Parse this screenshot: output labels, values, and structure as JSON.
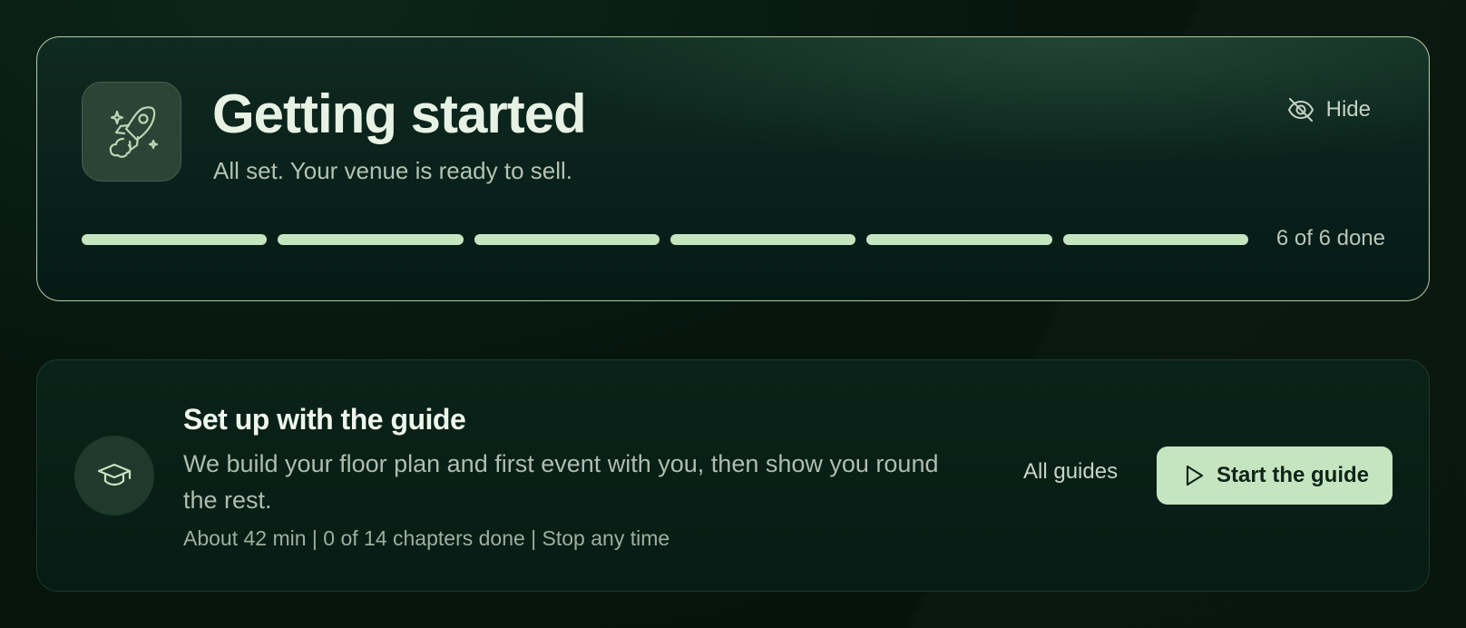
{
  "getting_started": {
    "title": "Getting started",
    "subtitle": "All set. Your venue is ready to sell.",
    "icon": "rocket-icon",
    "hide_label": "Hide",
    "hide_icon": "eye-off-icon",
    "progress": {
      "completed": 6,
      "total": 6,
      "label": "6 of 6 done"
    }
  },
  "guide": {
    "icon": "graduation-cap-icon",
    "title": "Set up with the guide",
    "description": "We build your floor plan and first event with you, then show you round the rest.",
    "meta": "About 42 min | 0 of 14 chapters done | Stop any time",
    "all_guides_label": "All guides",
    "start_label": "Start the guide",
    "start_icon": "play-icon"
  },
  "colors": {
    "accent": "#c5e5c0",
    "background": "#06160f"
  }
}
